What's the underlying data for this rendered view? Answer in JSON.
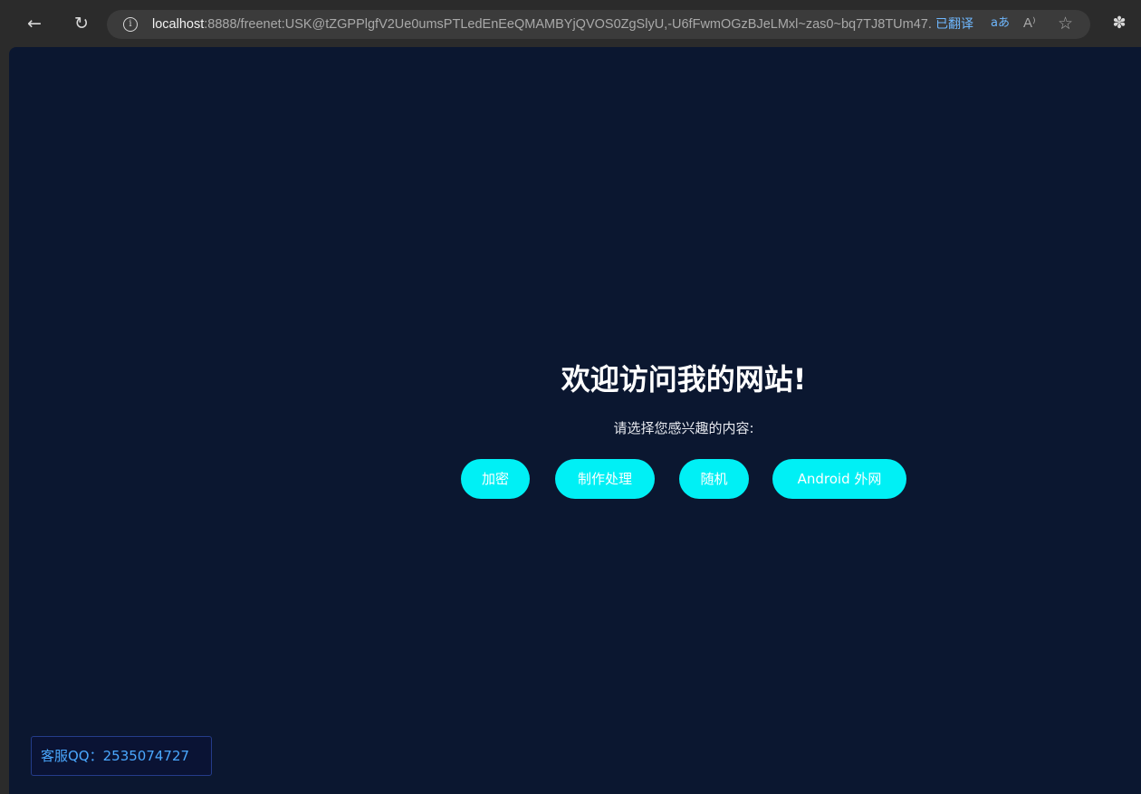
{
  "browser": {
    "url_host": "localhost",
    "url_rest": ":8888/freenet:USK@tZGPPlgfV2Ue0umsPTLedEnEeQMAMBYjQVOS0ZgSlyU,-U6fFwmOGzBJeLMxl~zas0~bq7TJ8TUm47...",
    "translated_label": "已翻译",
    "translate_icon_text": "aあ",
    "read_aloud_icon_text": "A⁾",
    "icons": [
      "back-arrow-icon",
      "reload-icon",
      "info-icon",
      "translate-icon",
      "read-aloud-icon",
      "star-icon",
      "extensions-icon"
    ]
  },
  "page": {
    "title": "欢迎访问我的网站!",
    "subtitle": "请选择您感兴趣的内容:",
    "buttons": [
      "加密",
      "制作处理",
      "随机",
      "Android 外网"
    ],
    "support": "客服QQ：2535074727",
    "colors": {
      "background": "#0b1730",
      "button": "#00f0f5",
      "support_text": "#4aa8ff"
    }
  }
}
